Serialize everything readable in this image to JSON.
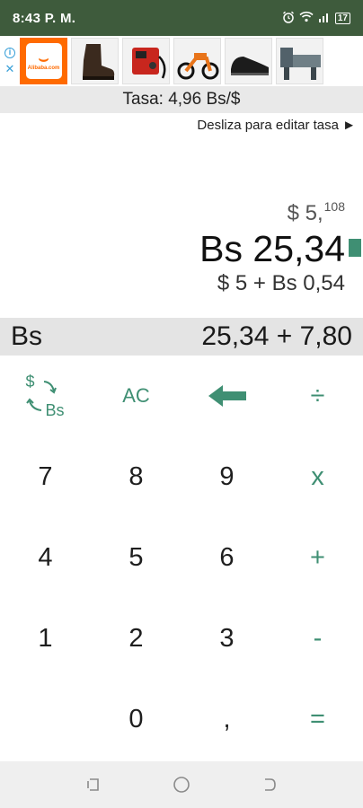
{
  "status_bar": {
    "time": "8:43 P. M.",
    "battery": "17"
  },
  "ad": {
    "info_icon": "info-icon",
    "close_label": "✕",
    "tiles": [
      {
        "name": "alibaba-logo",
        "text": "Alibaba.com"
      },
      {
        "name": "boot-image"
      },
      {
        "name": "welder-image"
      },
      {
        "name": "dirt-bike-image"
      },
      {
        "name": "shoe-image"
      },
      {
        "name": "lathe-image"
      }
    ]
  },
  "rate": {
    "label": "Tasa: 4,96 Bs/$",
    "hint": "Desliza para editar tasa ►"
  },
  "display": {
    "usd_main": "$ 5,",
    "usd_sup": "108",
    "bs_value": "Bs 25,34",
    "breakdown": "$ 5 + Bs 0,54"
  },
  "expression": {
    "currency": "Bs",
    "value": "25,34 + 7,80"
  },
  "keypad": {
    "swap": {
      "dollar": "$",
      "bs": "Bs"
    },
    "clear": "AC",
    "divide": "÷",
    "multiply": "x",
    "plus": "+",
    "minus": "-",
    "equals": "=",
    "comma": ",",
    "digits": {
      "d0": "0",
      "d1": "1",
      "d2": "2",
      "d3": "3",
      "d4": "4",
      "d5": "5",
      "d6": "6",
      "d7": "7",
      "d8": "8",
      "d9": "9"
    }
  },
  "colors": {
    "status_bar": "#3e5b3c",
    "accent": "#3f8f73",
    "rate_bar": "#e9e9e9",
    "expression_bar": "#e4e4e4"
  }
}
